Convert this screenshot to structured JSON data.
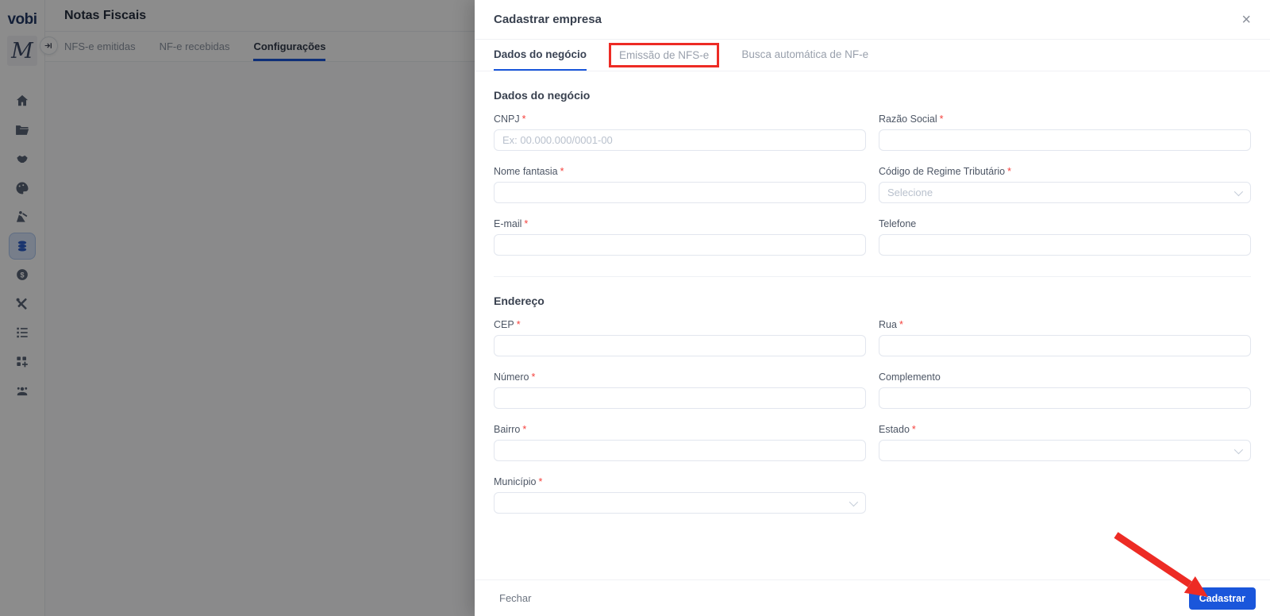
{
  "app": {
    "brand": "vobi",
    "avatar_letter": "M",
    "page_title": "Notas Fiscais",
    "main_tabs": [
      {
        "label": "NFS-e emitidas",
        "active": false
      },
      {
        "label": "NF-e recebidas",
        "active": false
      },
      {
        "label": "Configurações",
        "active": true
      }
    ],
    "sidebar_icons": [
      "home",
      "projects-folder",
      "handshake",
      "palette",
      "construction",
      "invoices-coins",
      "finance-dollar",
      "tools",
      "checklist",
      "apps-add",
      "community"
    ],
    "active_sidebar_icon": "invoices-coins"
  },
  "drawer": {
    "title": "Cadastrar empresa",
    "close_icon": "×",
    "tabs": [
      {
        "label": "Dados do negócio",
        "active": true,
        "annotated": false
      },
      {
        "label": "Emissão de NFS-e",
        "active": false,
        "annotated": true
      },
      {
        "label": "Busca automática de NF-e",
        "active": false,
        "annotated": false
      }
    ],
    "sections": [
      {
        "heading": "Dados do negócio",
        "fields": [
          {
            "label": "CNPJ",
            "required": true,
            "control": "input",
            "placeholder": "Ex: 00.000.000/0001-00",
            "value": ""
          },
          {
            "label": "Razão Social",
            "required": true,
            "control": "input",
            "placeholder": "",
            "value": ""
          },
          {
            "label": "Nome fantasia",
            "required": true,
            "control": "input",
            "placeholder": "",
            "value": ""
          },
          {
            "label": "Código de Regime Tributário",
            "required": true,
            "control": "select",
            "placeholder": "Selecione"
          },
          {
            "label": "E-mail",
            "required": true,
            "control": "input",
            "placeholder": "",
            "value": ""
          },
          {
            "label": "Telefone",
            "required": false,
            "control": "input",
            "placeholder": "",
            "value": ""
          }
        ]
      },
      {
        "heading": "Endereço",
        "fields": [
          {
            "label": "CEP",
            "required": true,
            "control": "input",
            "placeholder": "",
            "value": ""
          },
          {
            "label": "Rua",
            "required": true,
            "control": "input",
            "placeholder": "",
            "value": ""
          },
          {
            "label": "Número",
            "required": true,
            "control": "input",
            "placeholder": "",
            "value": ""
          },
          {
            "label": "Complemento",
            "required": false,
            "control": "input",
            "placeholder": "",
            "value": ""
          },
          {
            "label": "Bairro",
            "required": true,
            "control": "input",
            "placeholder": "",
            "value": ""
          },
          {
            "label": "Estado",
            "required": true,
            "control": "select",
            "placeholder": ""
          },
          {
            "label": "Município",
            "required": true,
            "control": "select",
            "placeholder": ""
          }
        ]
      }
    ],
    "footer": {
      "close_label": "Fechar",
      "submit_label": "Cadastrar"
    }
  },
  "annotations": {
    "color": "#ed2b24",
    "box_target": "tab Emissão de NFS-e",
    "arrow_target": "Cadastrar button"
  },
  "colors": {
    "accent_blue": "#1a56db",
    "required_star": "#f5413d"
  }
}
